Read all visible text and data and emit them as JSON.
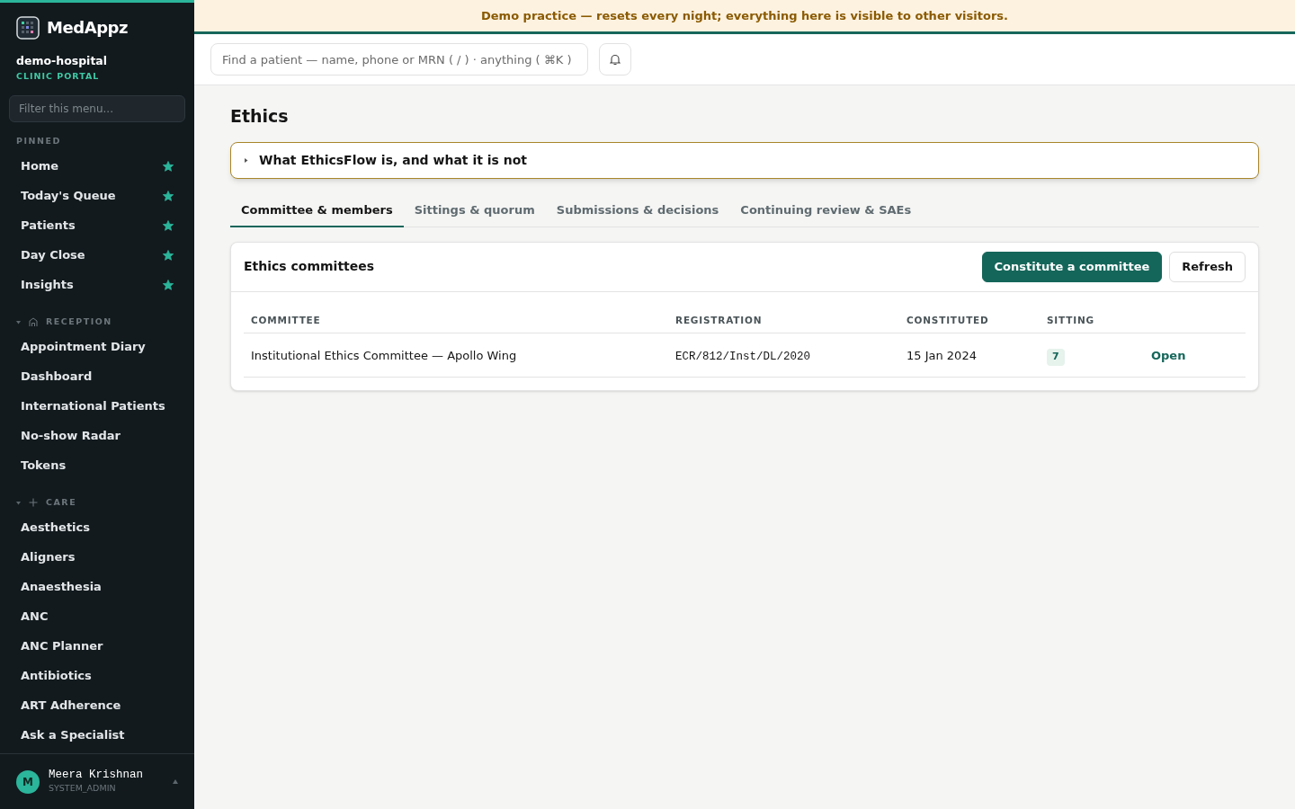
{
  "brand": {
    "name": "MedAppz",
    "org": "demo-hospital",
    "portal": "CLINIC PORTAL"
  },
  "sidebar": {
    "filter_placeholder": "Filter this menu...",
    "pinned": {
      "title": "PINNED",
      "items": [
        {
          "label": "Home",
          "starred": true
        },
        {
          "label": "Today's Queue",
          "starred": true
        },
        {
          "label": "Patients",
          "starred": true
        },
        {
          "label": "Day Close",
          "starred": true
        },
        {
          "label": "Insights",
          "starred": true
        }
      ]
    },
    "groups": [
      {
        "title": "RECEPTION",
        "expanded": true,
        "items": [
          "Appointment Diary",
          "Dashboard",
          "International Patients",
          "No-show Radar",
          "Tokens"
        ]
      },
      {
        "title": "CARE",
        "expanded": true,
        "items": [
          "Aesthetics",
          "Aligners",
          "Anaesthesia",
          "ANC",
          "ANC Planner",
          "Antibiotics",
          "ART Adherence",
          "Ask a Specialist"
        ]
      }
    ],
    "user": {
      "initial": "M",
      "name": "Meera Krishnan",
      "role": "SYSTEM_ADMIN"
    }
  },
  "banner": "Demo practice — resets every night; everything here is visible to other visitors.",
  "search": {
    "placeholder": "Find a patient — name, phone or MRN ( / ) · anything ( ⌘K )"
  },
  "page": {
    "title": "Ethics",
    "disclosure": {
      "label": "What EthicsFlow is, and what it is not",
      "expanded": false
    },
    "tabs": [
      {
        "label": "Committee & members",
        "selected": true
      },
      {
        "label": "Sittings & quorum",
        "selected": false
      },
      {
        "label": "Submissions & decisions",
        "selected": false
      },
      {
        "label": "Continuing review & SAEs",
        "selected": false
      }
    ],
    "card": {
      "title": "Ethics committees",
      "buttons": [
        {
          "label": "Constitute a committee",
          "kind": "primary"
        },
        {
          "label": "Refresh",
          "kind": "secondary"
        }
      ],
      "table": {
        "columns": [
          "COMMITTEE",
          "REGISTRATION",
          "CONSTITUTED",
          "SITTING"
        ],
        "rows": [
          {
            "committee": "Institutional Ethics Committee — Apollo Wing",
            "registration": "ECR/812/Inst/DL/2020",
            "constituted": "15 Jan 2024",
            "sitting": "7",
            "action": "Open"
          }
        ]
      }
    }
  }
}
